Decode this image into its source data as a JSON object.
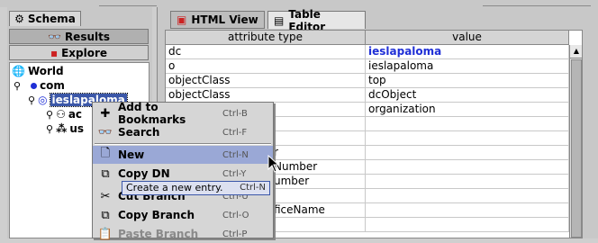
{
  "left_tabs": {
    "schema": "Schema",
    "results": "Results",
    "explore": "Explore"
  },
  "tree": {
    "root": "World",
    "level1": "com",
    "selected": "ieslapaloma",
    "child1": "ac",
    "child2": "us"
  },
  "right_tabs": {
    "html_view": "HTML View",
    "table_editor": "Table Editor"
  },
  "table": {
    "headers": [
      "attribute type",
      "value"
    ],
    "rows": [
      {
        "attr": "dc",
        "value": "ieslapaloma",
        "value_blue": true
      },
      {
        "attr": "o",
        "value": "ieslapaloma"
      },
      {
        "attr": "objectClass",
        "value": "top"
      },
      {
        "attr": "objectClass",
        "value": "dcObject"
      },
      {
        "attr": "",
        "value": "organization"
      },
      {
        "attr": "",
        "value": ""
      },
      {
        "attr": "",
        "value": ""
      },
      {
        "attr": "r",
        "value": ""
      },
      {
        "attr": "Number",
        "value": ""
      },
      {
        "attr": "umber",
        "value": ""
      },
      {
        "attr": "",
        "value": ""
      },
      {
        "attr": "ficeName",
        "value": ""
      },
      {
        "attr": "",
        "value": ""
      }
    ]
  },
  "menu": {
    "items": [
      {
        "label": "Add to Bookmarks",
        "shortcut": "Ctrl-B",
        "icon": "plus-icon"
      },
      {
        "label": "Search",
        "shortcut": "Ctrl-F",
        "icon": "binoculars-icon"
      },
      {
        "label": "New",
        "shortcut": "Ctrl-N",
        "icon": "new-document-icon"
      },
      {
        "label": "Copy DN",
        "shortcut": "Ctrl-Y",
        "icon": "copy-icon"
      },
      {
        "label": "Cut Branch",
        "shortcut": "Ctrl-U",
        "icon": "scissors-icon"
      },
      {
        "label": "Copy Branch",
        "shortcut": "Ctrl-O",
        "icon": "copy-icon"
      },
      {
        "label": "Paste Branch",
        "shortcut": "Ctrl-P",
        "icon": "paste-icon"
      }
    ]
  },
  "tooltip": {
    "text": "Create a new entry.",
    "shortcut": "Ctrl-N"
  }
}
